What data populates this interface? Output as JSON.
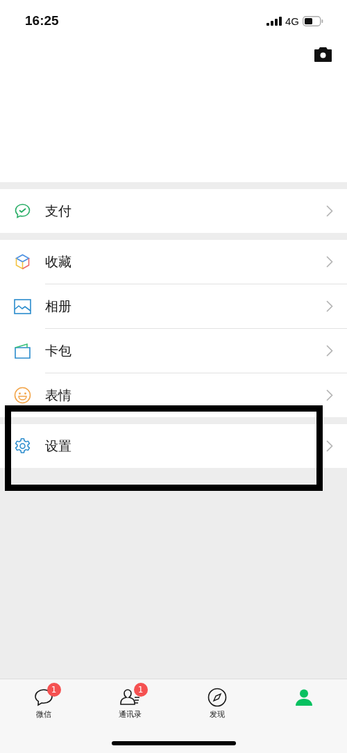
{
  "status_bar": {
    "time": "16:25",
    "network": "4G"
  },
  "sections": [
    {
      "items": [
        {
          "label": "支付",
          "highlighted": false
        }
      ]
    },
    {
      "items": [
        {
          "label": "收藏",
          "highlighted": false
        },
        {
          "label": "相册",
          "highlighted": false
        },
        {
          "label": "卡包",
          "highlighted": false
        },
        {
          "label": "表情",
          "highlighted": false
        }
      ]
    },
    {
      "items": [
        {
          "label": "设置",
          "highlighted": true
        }
      ]
    }
  ],
  "tab_bar": [
    {
      "label": "微信",
      "badge": "1",
      "selected": false
    },
    {
      "label": "通讯录",
      "badge": "1",
      "selected": false
    },
    {
      "label": "发现",
      "selected": false
    },
    {
      "selected": true
    }
  ]
}
